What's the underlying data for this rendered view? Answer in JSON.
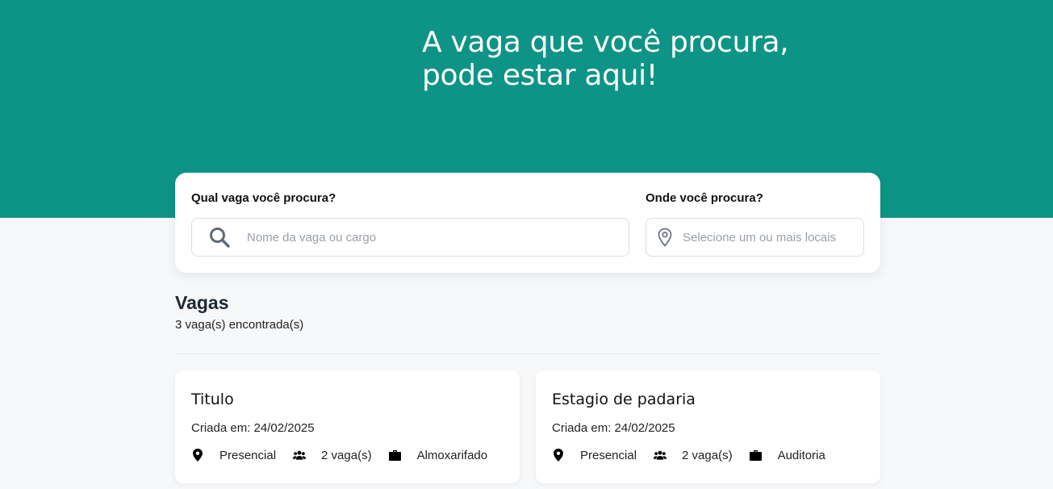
{
  "hero": {
    "line1": "A vaga que você procura,",
    "line2": "pode estar aqui!",
    "bg_color": "#0e9486"
  },
  "search": {
    "what_label": "Qual vaga você procura?",
    "what_placeholder": "Nome da vaga ou cargo",
    "where_label": "Onde você procura?",
    "where_placeholder": "Selecione um ou mais locais",
    "what_icon": "search-icon",
    "where_icon": "map-pin-icon"
  },
  "jobs_section": {
    "title": "Vagas",
    "count": "3 vaga(s) encontrada(s)",
    "items": [
      {
        "title": "Titulo",
        "created": "Criada em: 24/02/2025",
        "modality": "Presencial",
        "openings": "2 vaga(s)",
        "area": "Almoxarifado"
      },
      {
        "title": "Estagio de padaria",
        "created": "Criada em: 24/02/2025",
        "modality": "Presencial",
        "openings": "2 vaga(s)",
        "area": "Auditoria"
      }
    ]
  }
}
